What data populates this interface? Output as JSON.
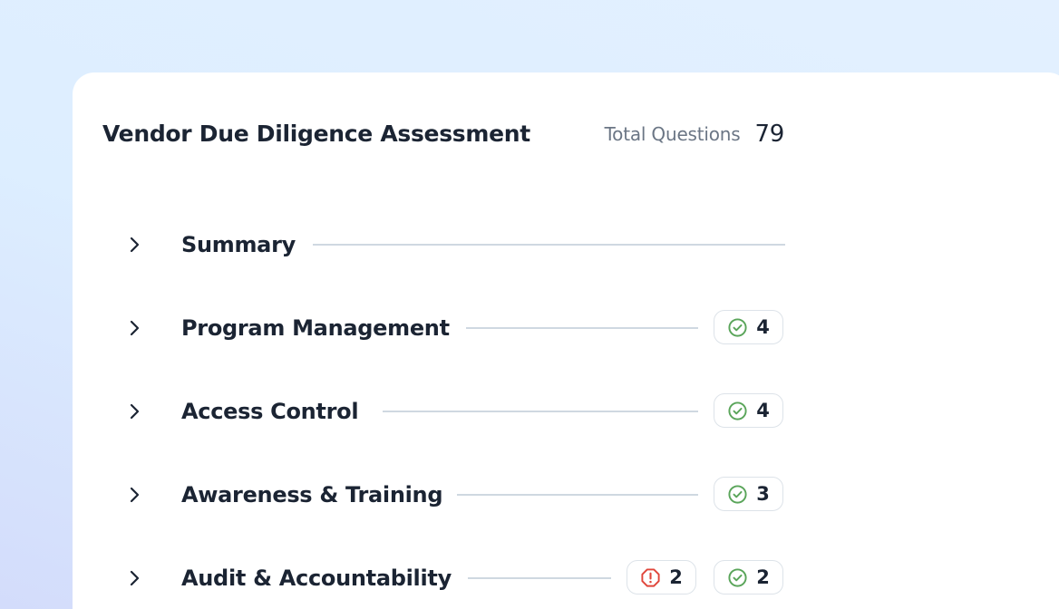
{
  "assessment": {
    "title": "Vendor Due Diligence Assessment",
    "total_label": "Total Questions",
    "total_value": "79"
  },
  "sections": [
    {
      "label": "Summary",
      "badges": []
    },
    {
      "label": "Program Management",
      "badges": [
        {
          "type": "complete",
          "icon": "check-circle-icon",
          "count": "4"
        }
      ]
    },
    {
      "label": "Access Control",
      "badges": [
        {
          "type": "complete",
          "icon": "check-circle-icon",
          "count": "4"
        }
      ]
    },
    {
      "label": "Awareness & Training",
      "badges": [
        {
          "type": "complete",
          "icon": "check-circle-icon",
          "count": "3"
        }
      ]
    },
    {
      "label": "Audit & Accountability",
      "badges": [
        {
          "type": "issue",
          "icon": "alert-octagon-icon",
          "count": "2"
        },
        {
          "type": "complete",
          "icon": "check-circle-icon",
          "count": "2"
        }
      ]
    }
  ],
  "colors": {
    "complete": "#5aa55a",
    "issue": "#e0453a",
    "text": "#1b2433",
    "muted": "#6b7685"
  }
}
